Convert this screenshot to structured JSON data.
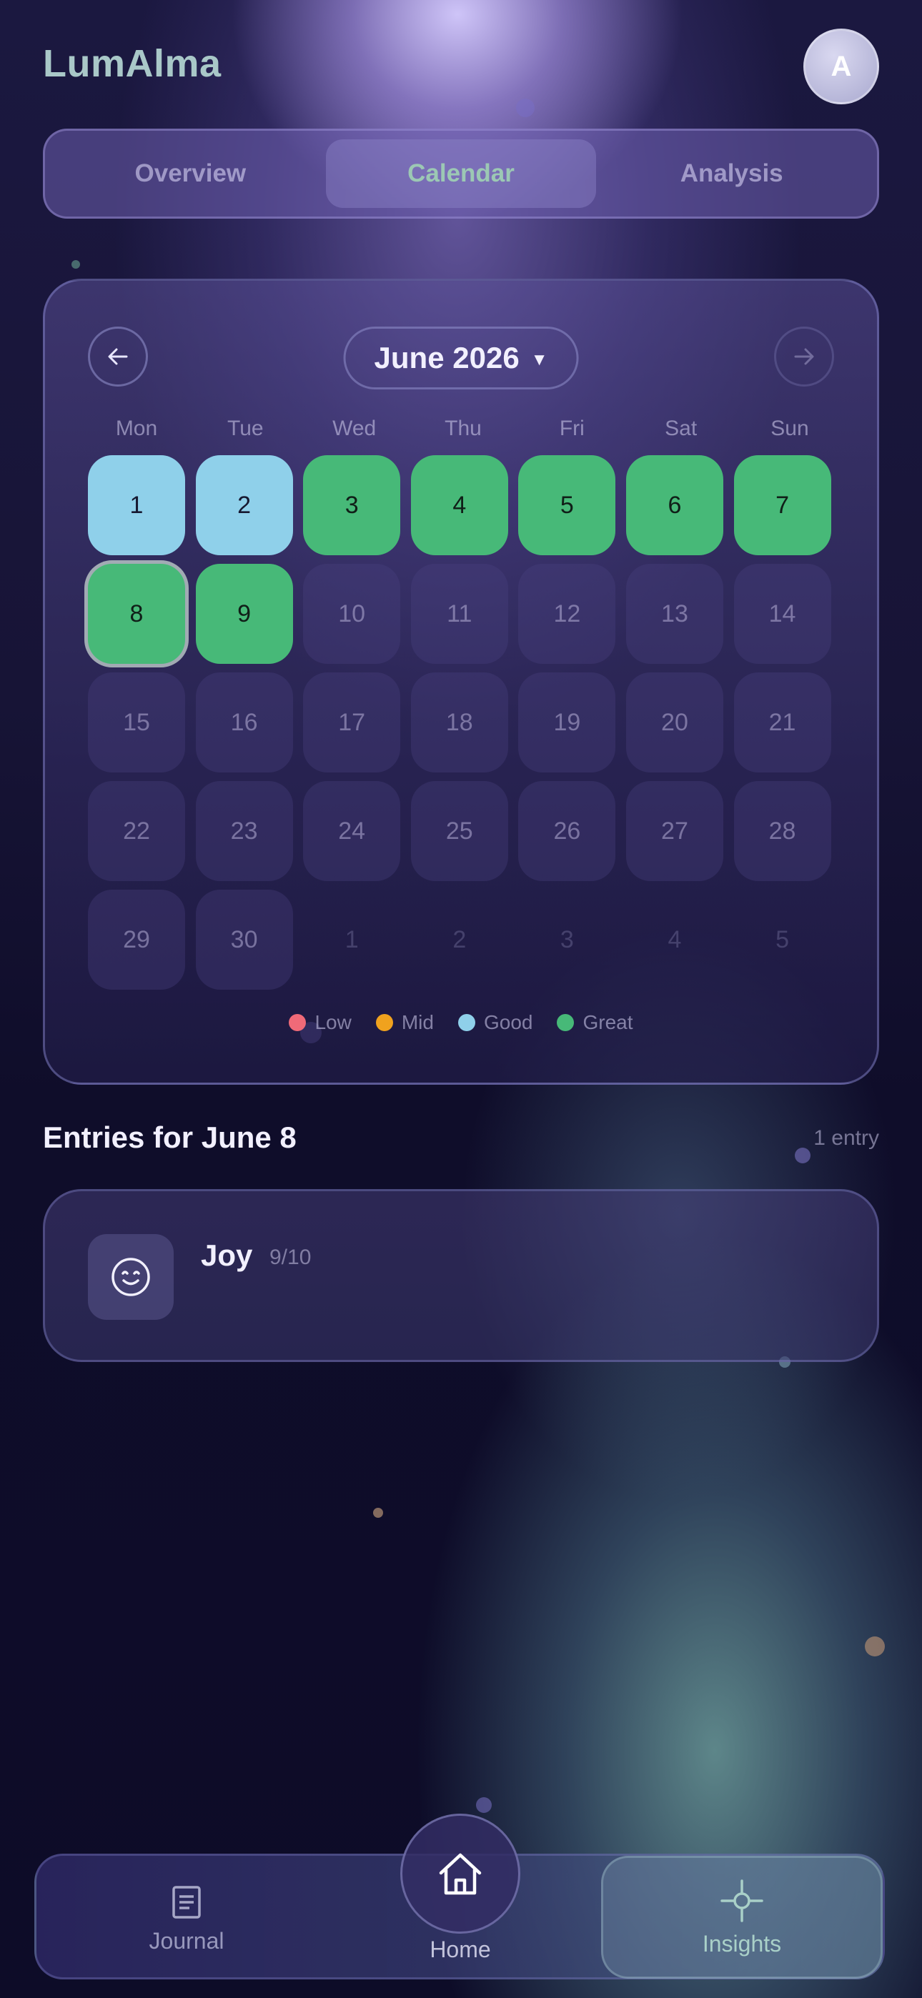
{
  "app": {
    "name": "LumAlma",
    "avatar_initial": "A"
  },
  "tabs": [
    {
      "label": "Overview",
      "active": false
    },
    {
      "label": "Calendar",
      "active": true
    },
    {
      "label": "Analysis",
      "active": false
    }
  ],
  "calendar": {
    "month_label": "June 2026",
    "weekdays": [
      "Mon",
      "Tue",
      "Wed",
      "Thu",
      "Fri",
      "Sat",
      "Sun"
    ],
    "days": [
      {
        "label": "1",
        "mood": "good"
      },
      {
        "label": "2",
        "mood": "good"
      },
      {
        "label": "3",
        "mood": "great"
      },
      {
        "label": "4",
        "mood": "great"
      },
      {
        "label": "5",
        "mood": "great"
      },
      {
        "label": "6",
        "mood": "great"
      },
      {
        "label": "7",
        "mood": "great"
      },
      {
        "label": "8",
        "mood": "great",
        "selected": true
      },
      {
        "label": "9",
        "mood": "great"
      },
      {
        "label": "10"
      },
      {
        "label": "11"
      },
      {
        "label": "12"
      },
      {
        "label": "13"
      },
      {
        "label": "14"
      },
      {
        "label": "15"
      },
      {
        "label": "16"
      },
      {
        "label": "17"
      },
      {
        "label": "18"
      },
      {
        "label": "19"
      },
      {
        "label": "20"
      },
      {
        "label": "21"
      },
      {
        "label": "22"
      },
      {
        "label": "23"
      },
      {
        "label": "24"
      },
      {
        "label": "25"
      },
      {
        "label": "26"
      },
      {
        "label": "27"
      },
      {
        "label": "28"
      },
      {
        "label": "29"
      },
      {
        "label": "30"
      },
      {
        "label": "1",
        "other_month": true
      },
      {
        "label": "2",
        "other_month": true
      },
      {
        "label": "3",
        "other_month": true
      },
      {
        "label": "4",
        "other_month": true
      },
      {
        "label": "5",
        "other_month": true
      }
    ],
    "legend": [
      {
        "label": "Low",
        "color": "#f06a78"
      },
      {
        "label": "Mid",
        "color": "#f0a21e"
      },
      {
        "label": "Good",
        "color": "#8fd0ea"
      },
      {
        "label": "Great",
        "color": "#47b978"
      }
    ]
  },
  "entries": {
    "title": "Entries for June 8",
    "count": "1 entry",
    "items": [
      {
        "label": "Joy",
        "score": "9/10",
        "icon": "smile-icon"
      }
    ]
  },
  "bottom_nav": {
    "journal": "Journal",
    "home": "Home",
    "insights": "Insights"
  }
}
